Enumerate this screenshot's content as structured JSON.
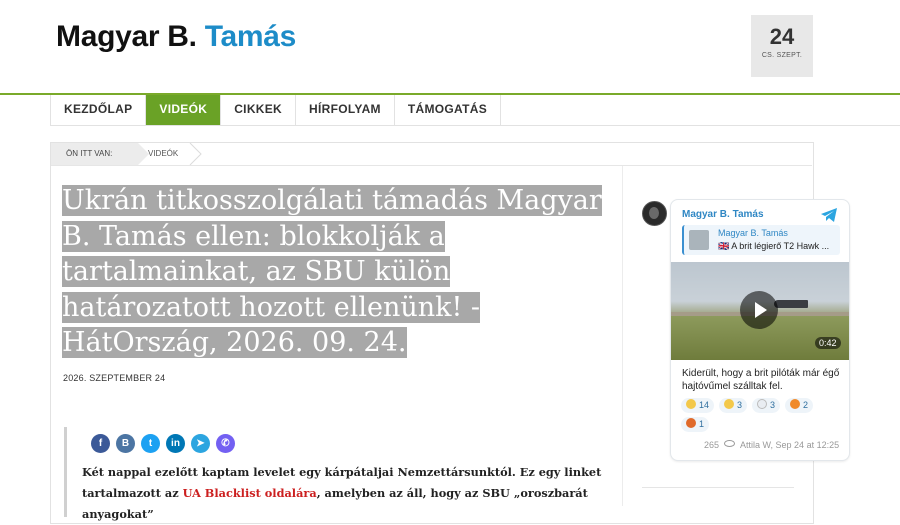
{
  "site": {
    "brand_part1": "Magyar B.",
    "brand_part2": "Tamás",
    "brand_accent_color": "#1d8cc8"
  },
  "datebox": {
    "day": "24",
    "month": "CS. SZEPT."
  },
  "nav": {
    "active_color": "#6aa226",
    "items": [
      "KEZDŐLAP",
      "VIDEÓK",
      "CIKKEK",
      "HÍRFOLYAM",
      "TÁMOGATÁS"
    ],
    "active": "VIDEÓK"
  },
  "breadcrumb": {
    "label": "ÖN ITT VAN:",
    "current": "VIDEÓK"
  },
  "article": {
    "title": "Ukrán titkosszolgálati támadás Magyar B. Tamás ellen: blokkolják a tartalmainkat, az SBU külön határozatott hozott ellenünk! - HátOrszág, 2026. 09. 24.",
    "date": "2026. SZEPTEMBER 24",
    "para_before_link": "Két nappal ezelőtt kaptam levelet egy kárpátaljai Nemzettársunktól. Ez egy linket tartalmazott az ",
    "link_text": "UA Blacklist oldalára",
    "para_after_link": ", amelyben az áll, hogy az SBU „oroszbarát anyagokat”",
    "share_icons": [
      "facebook-icon",
      "vk-icon",
      "twitter-icon",
      "linkedin-icon",
      "telegram-icon",
      "viber-icon"
    ]
  },
  "telegram": {
    "channel": "Magyar B. Tamás",
    "reply_name": "Magyar B. Tamás",
    "reply_text": "🇬🇧 A brit légierő T2 Hawk ...",
    "video_duration": "0:42",
    "text": "Kiderült, hogy a brit pilóták már égő hajtóvűmel szálltak fel.",
    "reactions": [
      {
        "count": "14",
        "color": "#f3c84a"
      },
      {
        "count": "3",
        "color": "#f3c84a"
      },
      {
        "count": "3",
        "color": "#e9edf2"
      },
      {
        "count": "2",
        "color": "#f08a2a"
      },
      {
        "count": "1",
        "color": "#e06a2a"
      }
    ],
    "views": "265",
    "meta": "Attila W, Sep 24 at 12:25"
  }
}
